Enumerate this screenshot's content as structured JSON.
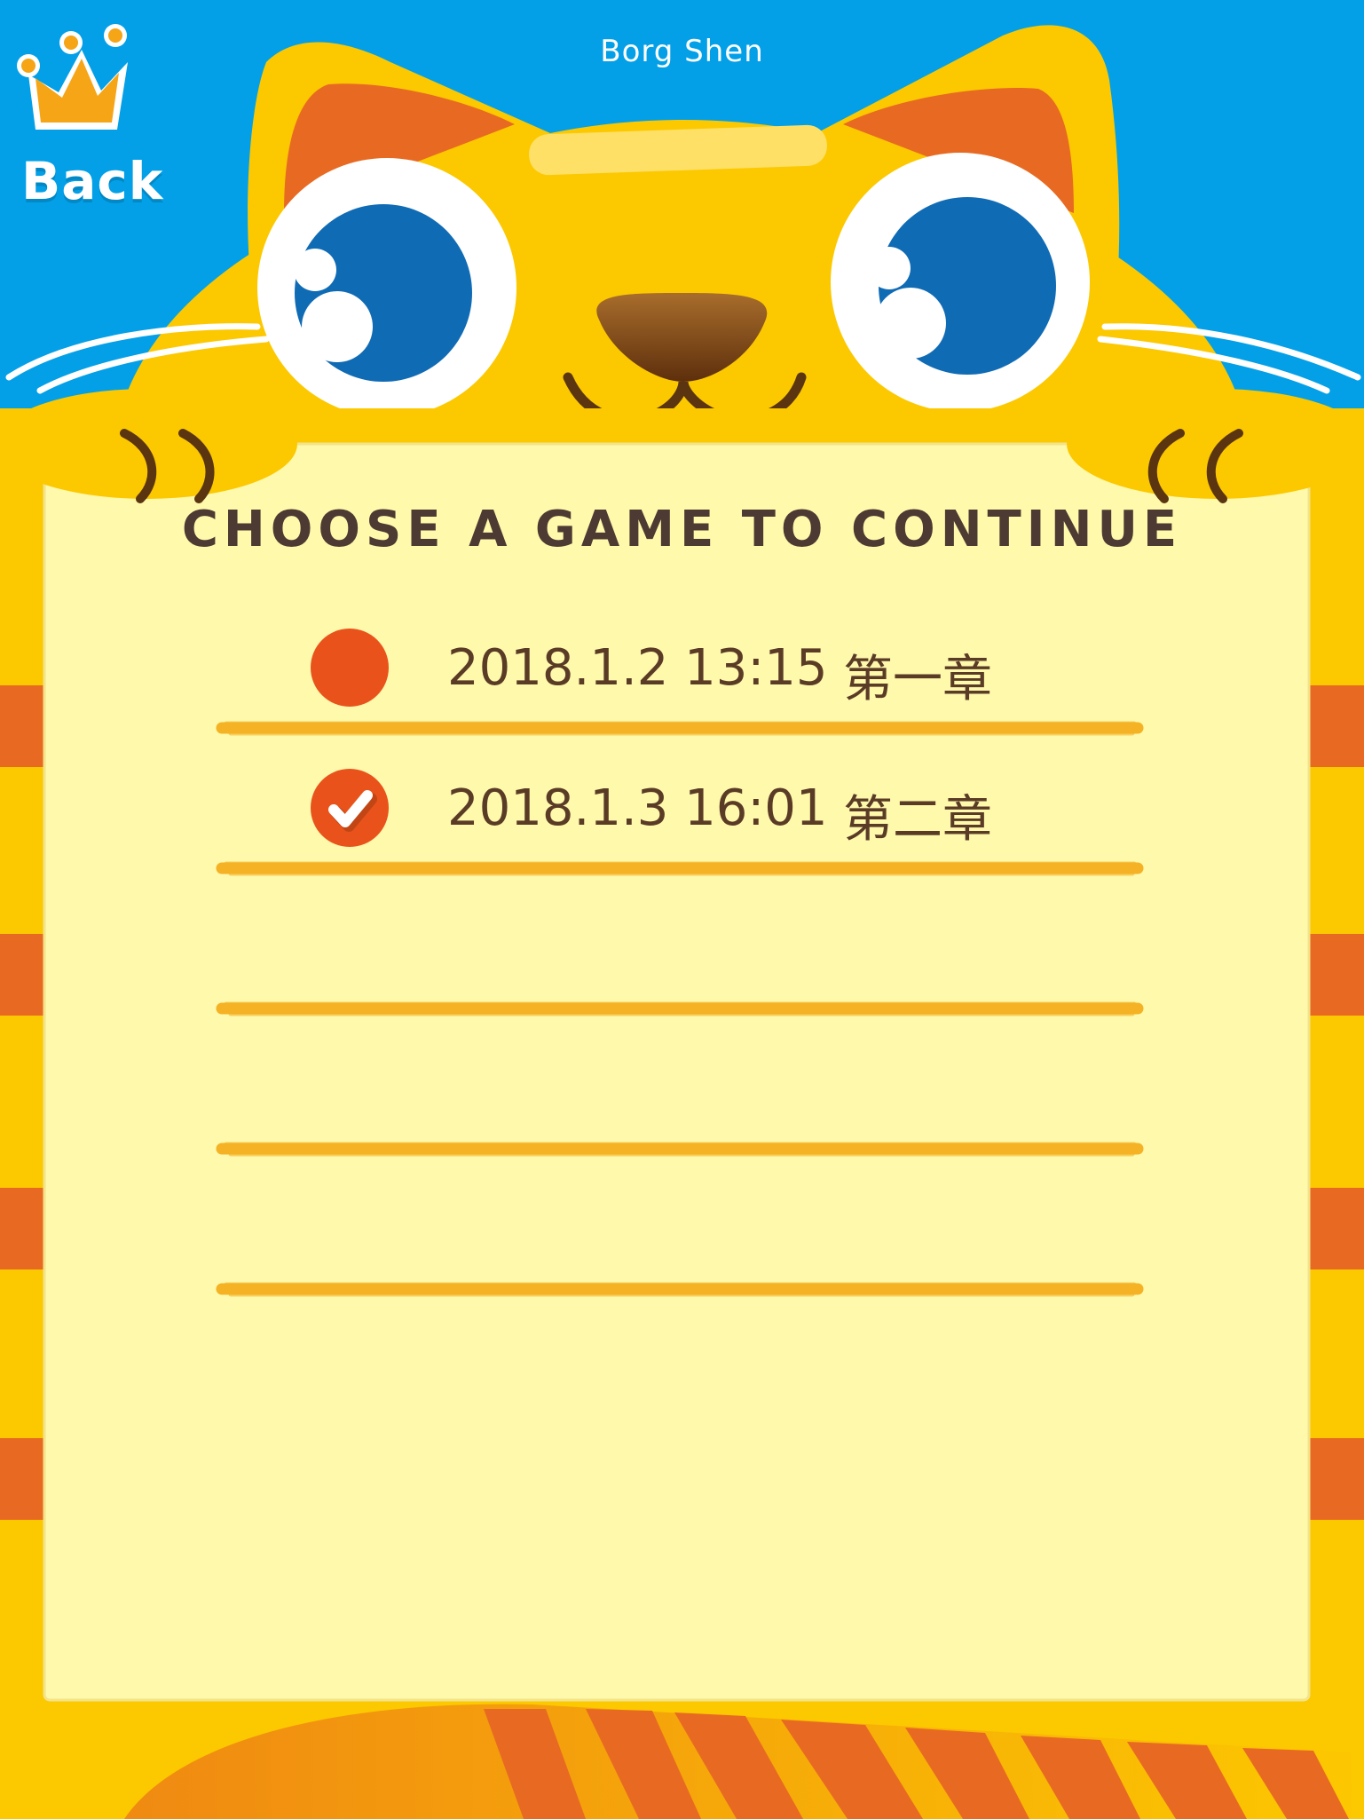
{
  "header": {
    "player_name": "Borg Shen"
  },
  "back": {
    "label": "Back",
    "icon": "crown-icon"
  },
  "panel": {
    "title": "CHOOSE A GAME TO CONTINUE"
  },
  "saves": [
    {
      "date": "2018.1.2 13:15",
      "chapter": "第一章",
      "selected": false
    },
    {
      "date": "2018.1.3 16:01",
      "chapter": "第二章",
      "selected": true
    }
  ],
  "empty_slots": 3,
  "colors": {
    "sky": "#03a0e8",
    "cat_body": "#fcc800",
    "stripe": "#e86a22",
    "panel": "#fff9ac",
    "line": "#f4b224",
    "marker": "#e9531b",
    "text": "#5a3c26"
  }
}
